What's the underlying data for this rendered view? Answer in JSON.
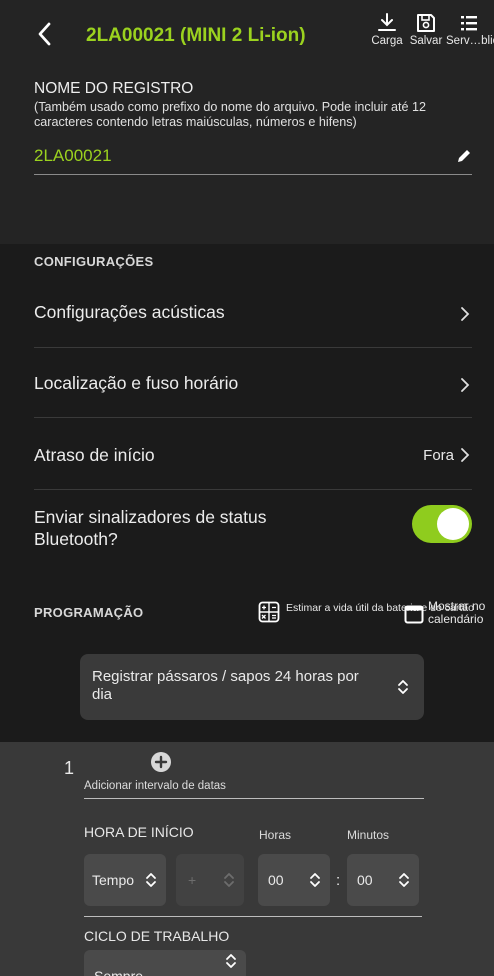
{
  "header": {
    "title": "2LA00021 (MINI 2 Li-ion)",
    "back_icon": "chevron-left-icon",
    "actions": [
      {
        "label": "Carga",
        "icon": "download-icon"
      },
      {
        "label": "Salvar",
        "icon": "save-icon"
      },
      {
        "label": "Serv…blica",
        "icon": "list-icon"
      }
    ]
  },
  "record": {
    "title": "NOME DO REGISTRO",
    "hint": "(Também usado como prefixo do nome do arquivo. Pode incluir até 12 caracteres contendo letras maiúsculas, números e hifens)",
    "value": "2LA00021",
    "edit_icon": "pencil-icon"
  },
  "settings": {
    "section_label": "CONFIGURAÇÕES",
    "rows": [
      {
        "label": "Configurações acústicas"
      },
      {
        "label": "Localização e fuso horário"
      },
      {
        "label": "Atraso de início",
        "value": "Fora"
      },
      {
        "label": "Enviar sinalizadores de status Bluetooth?",
        "toggle": true
      }
    ]
  },
  "programming": {
    "section_label": "PROGRAMAÇÃO",
    "battery_btn": "Estimar a vida útil da bateria e do cartão",
    "calendar_btn": "Mostrar no calendário",
    "preset": "Registrar pássaros / sapos 24 horas por dia",
    "schedule": {
      "index": "1",
      "add_range": "Adicionar intervalo de datas",
      "start_title": "HORA DE INÍCIO",
      "hours_label": "Horas",
      "minutes_label": "Minutos",
      "type_value": "Tempo",
      "offset_value": "+",
      "hours_value": "00",
      "minutes_value": "00",
      "colon": ":",
      "duty_title": "CICLO DE TRABALHO",
      "duty_value": "Sempre"
    }
  },
  "colors": {
    "accent": "#9bd21f",
    "toggle": "#8fcc1e",
    "background": "#1b1b1b",
    "panel": "#242424"
  }
}
